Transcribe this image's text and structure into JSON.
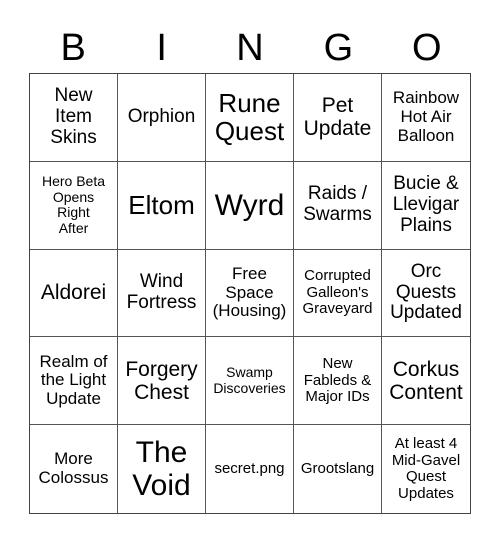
{
  "header": {
    "letters": [
      "B",
      "I",
      "N",
      "G",
      "O"
    ]
  },
  "cells": [
    "New\nItem\nSkins",
    "Orphion",
    "Rune\nQuest",
    "Pet\nUpdate",
    "Rainbow\nHot Air\nBalloon",
    "Hero Beta\nOpens\nRight\nAfter",
    "Eltom",
    "Wyrd",
    "Raids /\nSwarms",
    "Bucie &\nLlevigar\nPlains",
    "Aldorei",
    "Wind\nFortress",
    "Free\nSpace\n(Housing)",
    "Corrupted\nGalleon's\nGraveyard",
    "Orc\nQuests\nUpdated",
    "Realm of\nthe Light\nUpdate",
    "Forgery\nChest",
    "Swamp\nDiscoveries",
    "New\nFableds &\nMajor IDs",
    "Corkus\nContent",
    "More\nColossus",
    "The\nVoid",
    "secret.png",
    "Grootslang",
    "At least 4\nMid-Gavel\nQuest\nUpdates"
  ]
}
